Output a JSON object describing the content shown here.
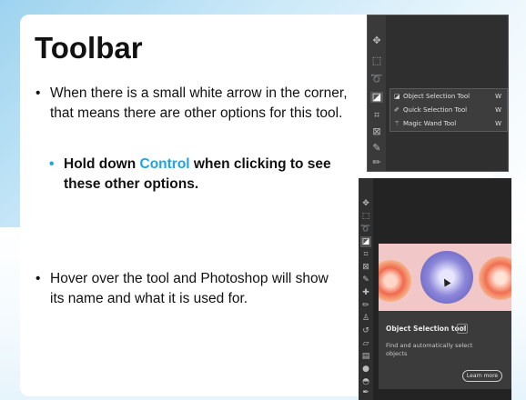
{
  "slide": {
    "title": "Toolbar",
    "bullets": [
      "When there is a small white arrow in the corner, that means there are other options for this tool.",
      "Hover over the tool and Photoshop will show its name and what it is used for."
    ],
    "sub_bullet": {
      "pre": "Hold down ",
      "highlight": "Control",
      "post": " when clicking to see these other options."
    },
    "bullet_symbol": "•"
  },
  "flyout_menu": {
    "items": [
      {
        "label": "Object Selection Tool",
        "shortcut": "W",
        "icon": "object-selection-icon",
        "selected": true
      },
      {
        "label": "Quick Selection Tool",
        "shortcut": "W",
        "icon": "quick-selection-icon",
        "selected": false
      },
      {
        "label": "Magic Wand Tool",
        "shortcut": "W",
        "icon": "magic-wand-icon",
        "selected": false
      }
    ]
  },
  "rich_tooltip": {
    "title": "Object Selection tool",
    "description": "Find and automatically select objects",
    "button": "Learn more"
  },
  "colors": {
    "accent": "#1aa6e6",
    "text": "#111111",
    "ps_dark": "#2f2f2f"
  }
}
